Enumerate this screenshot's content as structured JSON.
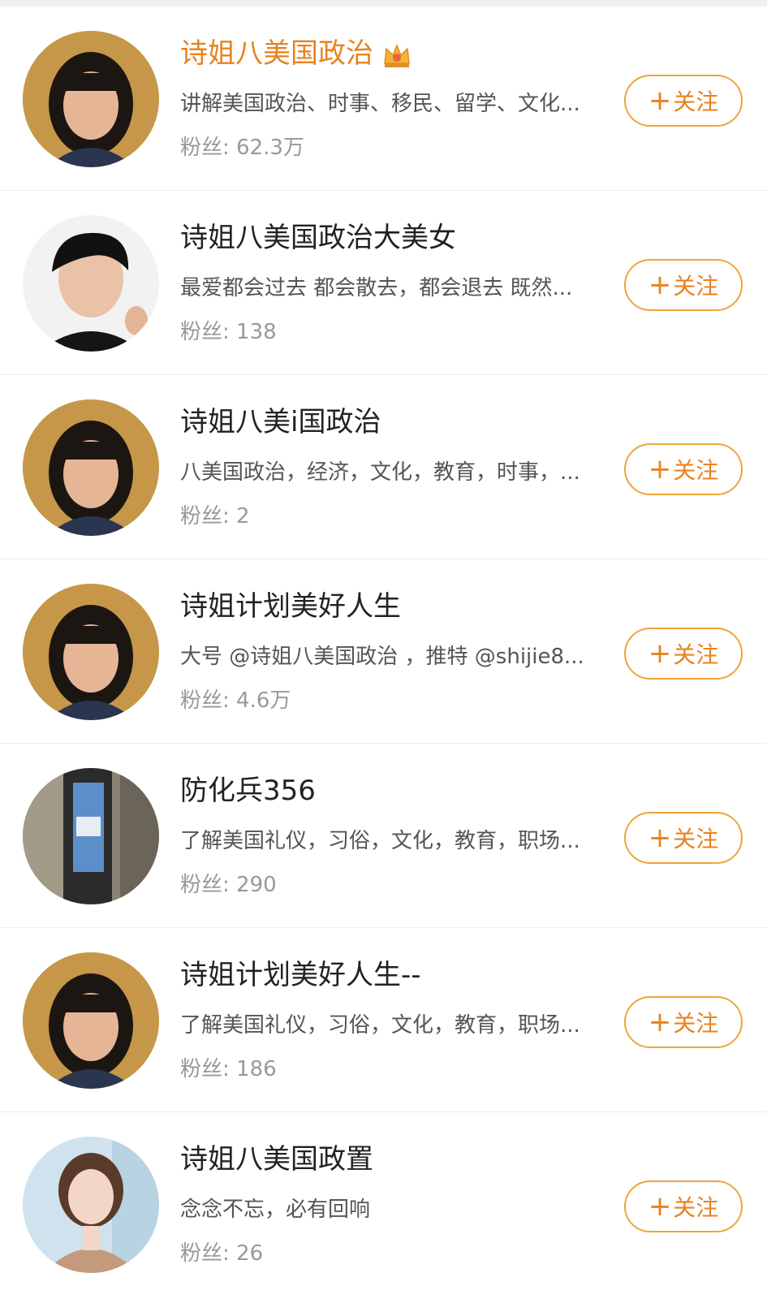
{
  "users": [
    {
      "name": "诗姐八美国政治",
      "vip": true,
      "desc": "讲解美国政治、时事、移民、留学、文化...",
      "fans_label": "粉丝:",
      "fans": "62.3万",
      "avatar": "woman-portrait-avatar",
      "follow_label": "关注",
      "follow_icon": "plus-icon"
    },
    {
      "name": "诗姐八美国政治大美女",
      "vip": false,
      "desc": "最爱都会过去 都会散去，都会退去 既然...",
      "fans_label": "粉丝:",
      "fans": "138",
      "avatar": "young-man-avatar",
      "follow_label": "关注",
      "follow_icon": "plus-icon"
    },
    {
      "name": "诗姐八美i国政治",
      "vip": false,
      "desc": "八美国政治，经济，文化，教育，时事，...",
      "fans_label": "粉丝:",
      "fans": "2",
      "avatar": "woman-portrait-avatar",
      "follow_label": "关注",
      "follow_icon": "plus-icon"
    },
    {
      "name": "诗姐计划美好人生",
      "vip": false,
      "desc": "大号 @诗姐八美国政治 ，推特 @shijie8...",
      "fans_label": "粉丝:",
      "fans": "4.6万",
      "avatar": "woman-portrait-avatar",
      "follow_label": "关注",
      "follow_icon": "plus-icon"
    },
    {
      "name": "防化兵356",
      "vip": false,
      "desc": "了解美国礼仪，习俗，文化，教育，职场...",
      "fans_label": "粉丝:",
      "fans": "290",
      "avatar": "elevator-screen-avatar",
      "follow_label": "关注",
      "follow_icon": "plus-icon"
    },
    {
      "name": "诗姐计划美好人生--",
      "vip": false,
      "desc": "了解美国礼仪，习俗，文化，教育，职场...",
      "fans_label": "粉丝:",
      "fans": "186",
      "avatar": "woman-portrait-avatar",
      "follow_label": "关注",
      "follow_icon": "plus-icon"
    },
    {
      "name": "诗姐八美国政置",
      "vip": false,
      "desc": "念念不忘，必有回响",
      "fans_label": "粉丝:",
      "fans": "26",
      "avatar": "smiling-woman-avatar",
      "follow_label": "关注",
      "follow_icon": "plus-icon"
    }
  ],
  "colors": {
    "vip_name": "#e8821f",
    "follow_border": "#f0a43a",
    "follow_text": "#e8821f",
    "desc_text": "#555555",
    "fans_text": "#999999",
    "divider": "#ececec"
  },
  "vip_badge_icon": "crown-icon"
}
